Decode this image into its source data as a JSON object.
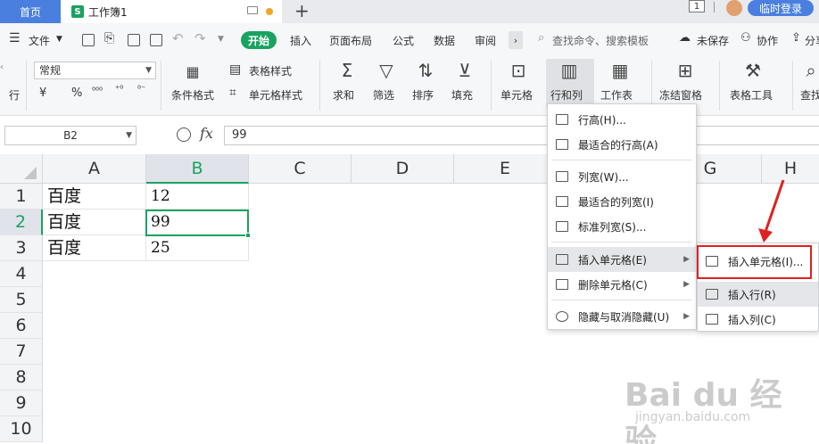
{
  "tabs": {
    "home": "首页",
    "doc": "工作簿1",
    "doc_icon": "S",
    "page_badge": "1"
  },
  "account": {
    "login": "临时登录"
  },
  "menu": {
    "file": "文件",
    "start": "开始",
    "items": [
      "插入",
      "页面布局",
      "公式",
      "数据",
      "审阅"
    ],
    "search": "查找命令、搜索模板",
    "unsaved": "未保存",
    "collab": "协作",
    "share": "分享"
  },
  "ribbon": {
    "font_select": "常规",
    "partial_left": "行",
    "cond_format": "条件格式",
    "table_style": "表格样式",
    "cell_style": "单元格样式",
    "sum": "求和",
    "filter": "筛选",
    "sort": "排序",
    "fill": "填充",
    "cell": "单元格",
    "rowcol": "行和列",
    "worksheet": "工作表",
    "freeze": "冻结窗格",
    "table_tools": "表格工具",
    "find": "查找"
  },
  "formula": {
    "name_box": "B2",
    "fx": "fx",
    "value": "99"
  },
  "grid": {
    "columns": [
      "A",
      "B",
      "C",
      "D",
      "E",
      "F",
      "G",
      "H"
    ],
    "rows": [
      "1",
      "2",
      "3",
      "4",
      "5",
      "6",
      "7",
      "8",
      "9",
      "10"
    ],
    "cells": [
      {
        "a": "百度",
        "b": "12"
      },
      {
        "a": "百度",
        "b": "99"
      },
      {
        "a": "百度",
        "b": "25"
      }
    ]
  },
  "rowcol_menu": {
    "items": [
      "行高(H)...",
      "最适合的行高(A)",
      "列宽(W)...",
      "最适合的列宽(I)",
      "标准列宽(S)...",
      "插入单元格(E)",
      "删除单元格(C)",
      "隐藏与取消隐藏(U)"
    ]
  },
  "insert_submenu": {
    "items": [
      "插入单元格(I)...",
      "插入行(R)",
      "插入列(C)"
    ]
  },
  "watermark": {
    "brand": "Bai du 经验",
    "url": "jingyan.baidu.com"
  },
  "colors": {
    "accent_green": "#1aa260",
    "tab_blue": "#4a7fe0",
    "highlight_red": "#e02020"
  }
}
